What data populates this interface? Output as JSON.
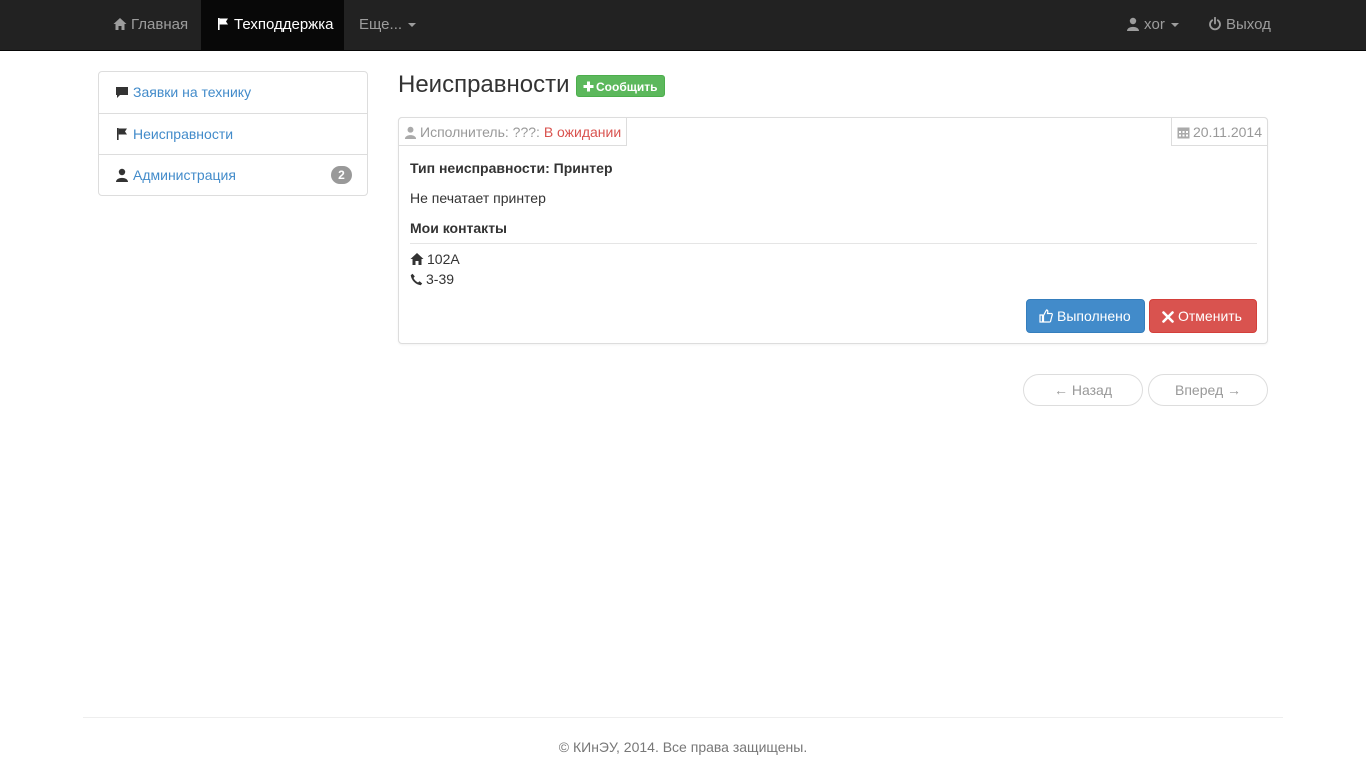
{
  "navbar": {
    "home": {
      "label": "Главная",
      "icon": "home-icon"
    },
    "support": {
      "label": "Техподдержка",
      "icon": "flag-icon"
    },
    "more": {
      "label": "Еще..."
    },
    "user": {
      "label": "xor",
      "icon": "user-icon"
    },
    "logout": {
      "label": "Выход",
      "icon": "power-icon"
    }
  },
  "sidebar": {
    "items": [
      {
        "label": "Заявки на технику",
        "icon": "comment-icon"
      },
      {
        "label": "Неисправности",
        "icon": "flag-icon"
      },
      {
        "label": "Администрация",
        "icon": "user-icon",
        "badge": "2"
      }
    ]
  },
  "main": {
    "title": "Неисправности",
    "report_button": {
      "label": "Сообщить",
      "icon": "plus-icon"
    }
  },
  "ticket": {
    "executor_label": "Исполнитель: ???:",
    "status": "В ожидании",
    "date": "20.11.2014",
    "fault_type": "Тип неисправности: Принтер",
    "description": "Не печатает принтер",
    "contacts_heading": "Мои контакты",
    "room": "102А",
    "phone": "3-39",
    "done_button": "Выполнено",
    "cancel_button": "Отменить"
  },
  "pager": {
    "prev": "← Назад",
    "next": "Вперед →"
  },
  "footer": {
    "text": "© КИнЭУ, 2014. Все права защищены."
  },
  "colors": {
    "navbar_bg": "#222222",
    "link": "#428bca",
    "success": "#5cb85c",
    "primary": "#428bca",
    "danger": "#d9534f"
  }
}
